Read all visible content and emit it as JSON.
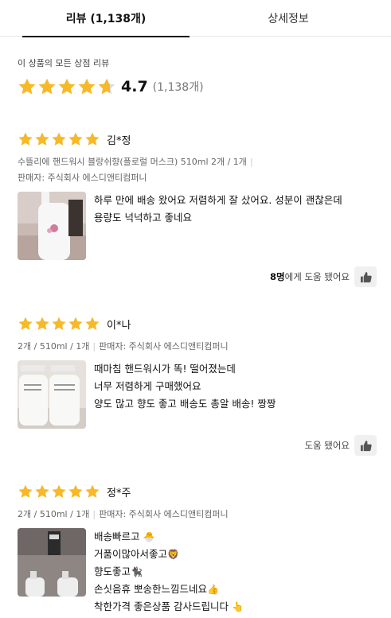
{
  "tabs": {
    "reviews": "리뷰 (1,138개)",
    "details": "상세정보"
  },
  "summary": {
    "caption": "이 상품의 모든 상점 리뷰",
    "rating_fraction": 0.94,
    "score": "4.7",
    "count": "(1,138개)"
  },
  "colors": {
    "star": "#f7b928",
    "star_empty": "#dddddd",
    "text": "#111111",
    "muted": "#666666"
  },
  "reviews": [
    {
      "author": "김*정",
      "rating": 5,
      "meta_line1": "수뜰리에 핸드워시 블랑쉬향(플로럴 머스크) 510ml 2개 / 1개",
      "meta_line2": "판매자: 주식회사 에스디앤티컴퍼니",
      "body": [
        "하루 만에 배송 왔어요 저렴하게 잘 샀어요. 성분이 괜찮은데",
        "용량도 넉넉하고 좋네요"
      ],
      "helpful_count": "8명",
      "helpful_suffix": "에게 도움 됐어요"
    },
    {
      "author": "이*나",
      "rating": 5,
      "meta_option": "2개 / 510ml / 1개",
      "meta_seller": "판매자: 주식회사 에스디앤티컴퍼니",
      "body": [
        "때마침 핸드워시가 똑! 떨어졌는데",
        "너무 저렴하게 구매했어요",
        "양도 많고 향도 좋고 배송도 총알 배송! 짱짱"
      ],
      "helpful_label": "도움 됐어요"
    },
    {
      "author": "정*주",
      "rating": 5,
      "meta_option": "2개 / 510ml / 1개",
      "meta_seller": "판매자: 주식회사 에스디앤티컴퍼니",
      "body": [
        "배송빠르고",
        "거품이많아서좋고",
        "향도좋고",
        "손싯음휴 뽀송한느낌드네요",
        "착한가격 좋은상품 감사드립니다"
      ],
      "body_emoji": [
        "🐣",
        "🦁",
        "🐈‍⬛",
        "👍",
        "👆"
      ]
    }
  ]
}
